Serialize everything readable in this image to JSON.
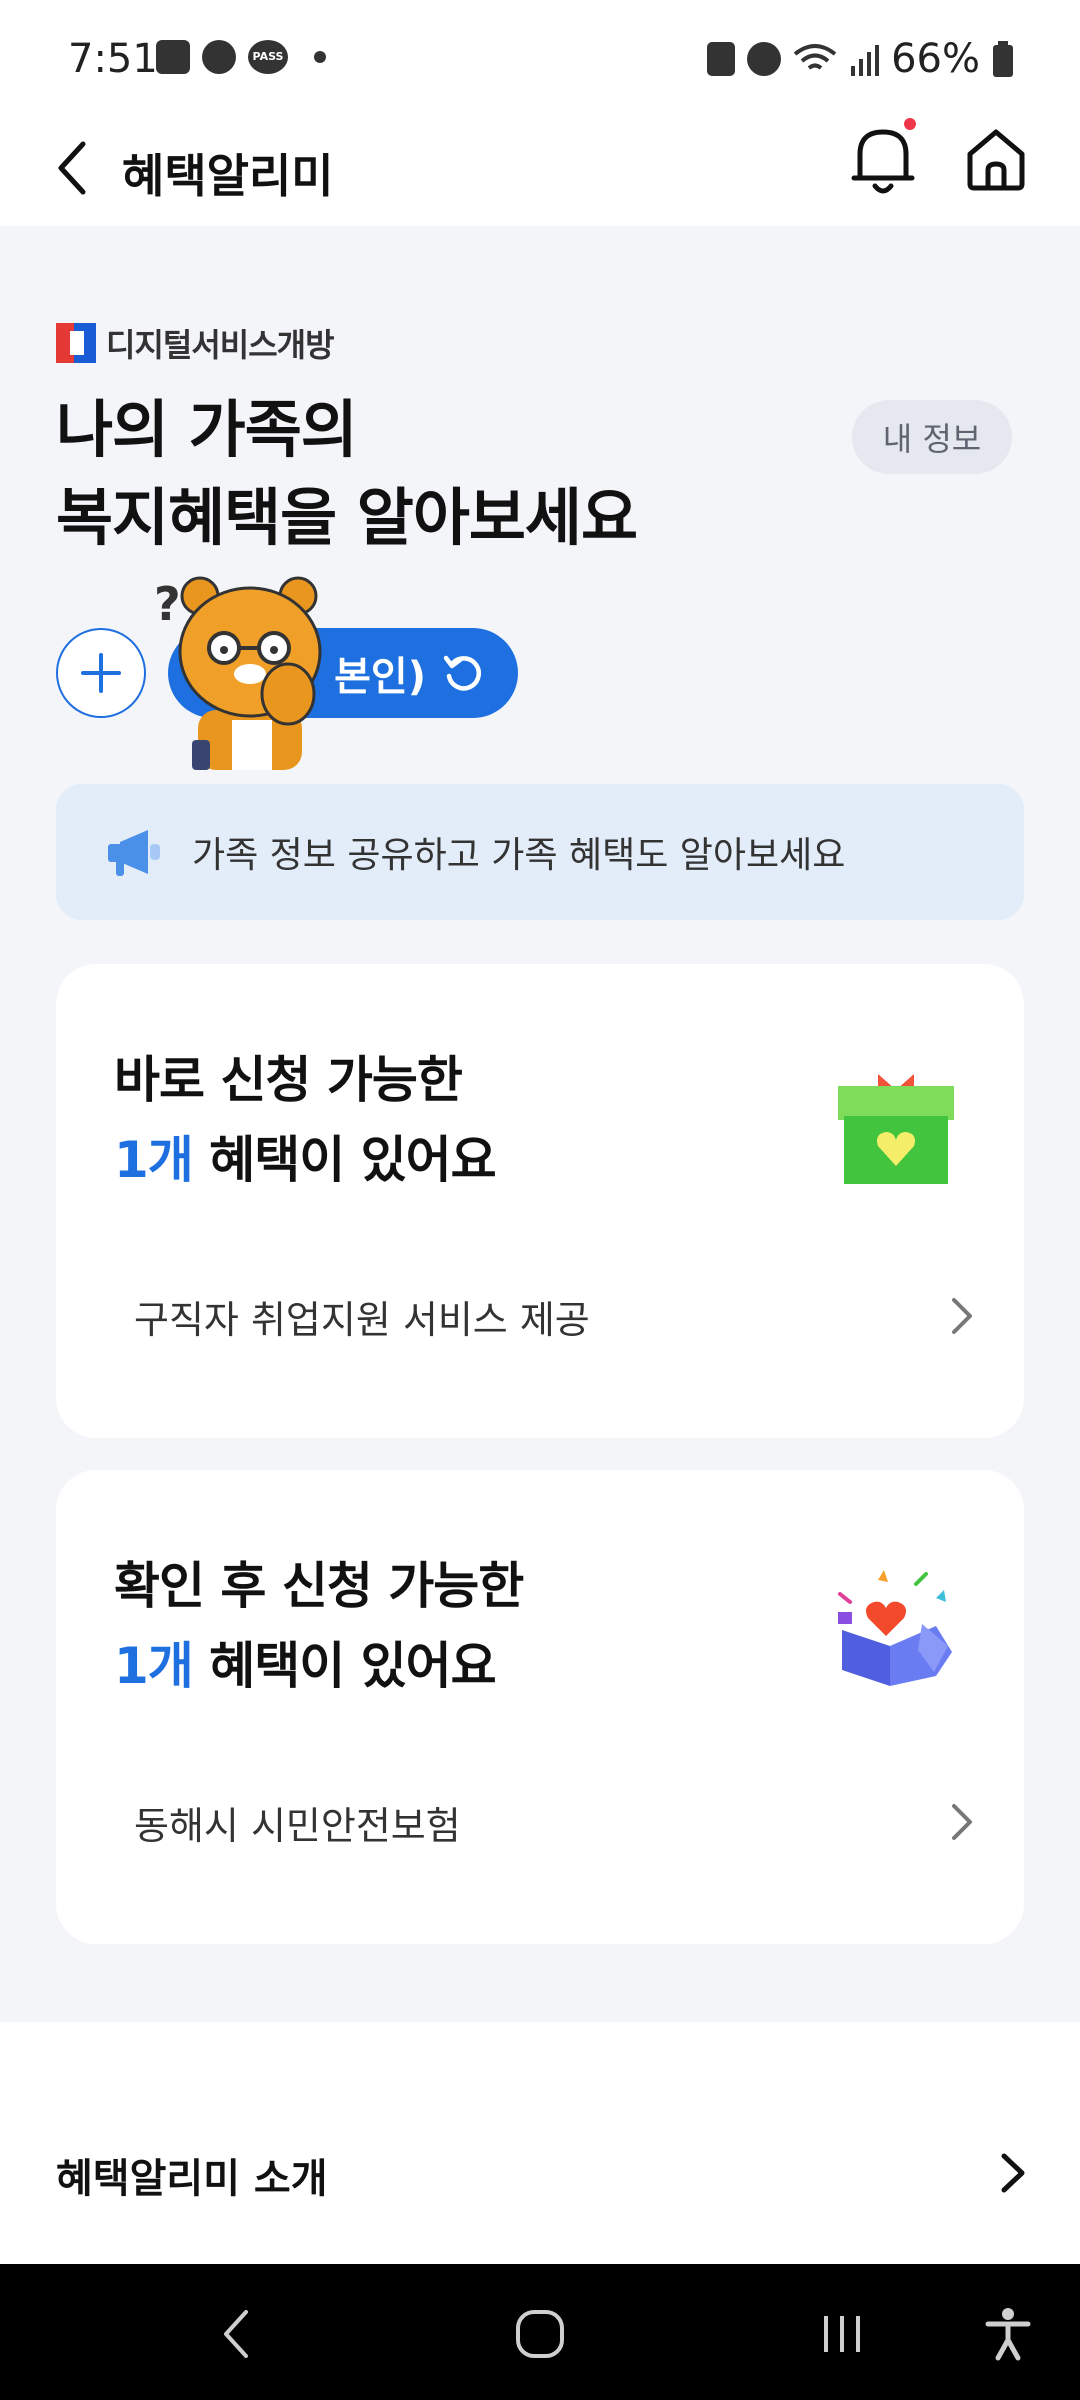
{
  "status_bar": {
    "time": "7:51",
    "battery": "66%"
  },
  "header": {
    "title": "혜택알리미"
  },
  "brand": {
    "name": "디지털서비스개방"
  },
  "main": {
    "title_line1": "나의 가족의",
    "title_line2": "복지혜택을 알아보세요",
    "my_info_label": "내 정보",
    "member_label": "본인)",
    "notice_text": "가족 정보 공유하고 가족 혜택도 알아보세요"
  },
  "cards": [
    {
      "title_line1": "바로 신청 가능한",
      "count": "1개",
      "title_line2_rest": " 혜택이 있어요",
      "item": "구직자 취업지원 서비스 제공",
      "icon": "gift-box-icon"
    },
    {
      "title_line1": "확인 후 신청 가능한",
      "count": "1개",
      "title_line2_rest": " 혜택이 있어요",
      "item": "동해시 시민안전보험",
      "icon": "heart-box-icon"
    }
  ],
  "footer": {
    "intro_label": "혜택알리미 소개"
  },
  "colors": {
    "accent": "#1e6fe0",
    "notice_bg": "#e3ecf9",
    "page_bg": "#f3f5f9"
  }
}
